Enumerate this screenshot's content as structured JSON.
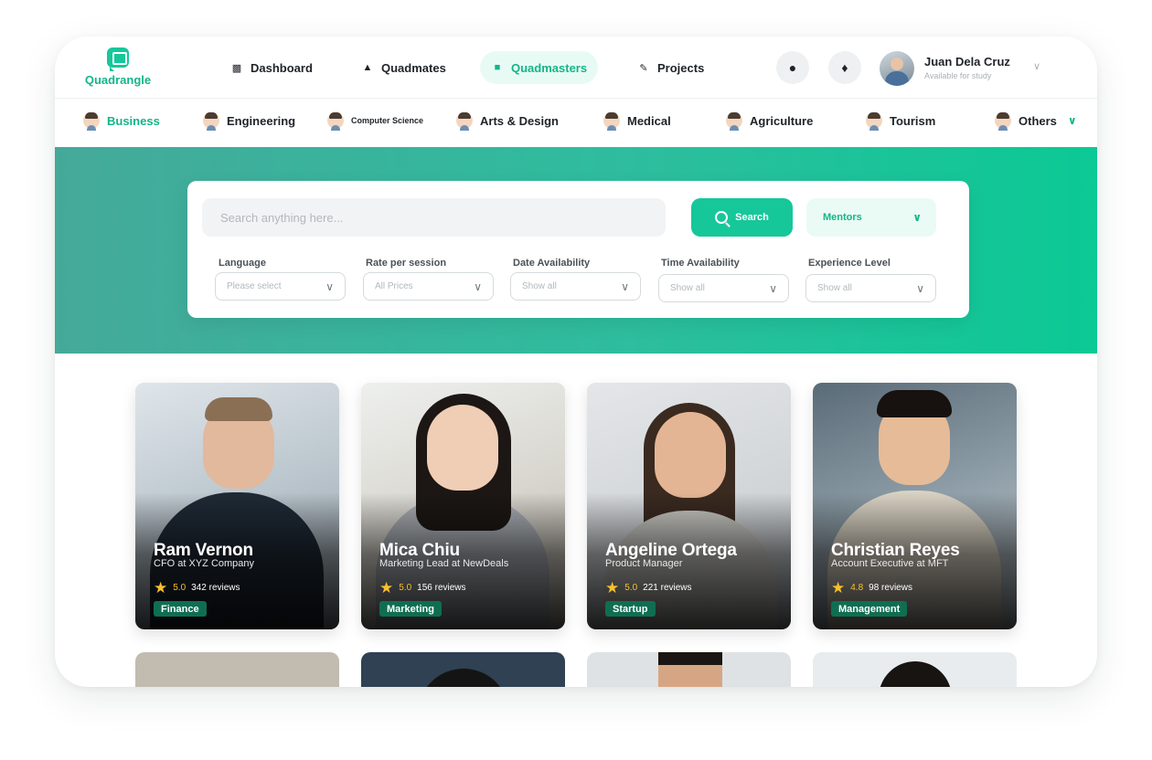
{
  "app": {
    "name": "Quadrangle"
  },
  "topnav": {
    "items": [
      {
        "label": "Dashboard",
        "icon": "calendar-icon",
        "active": false
      },
      {
        "label": "Quadmates",
        "icon": "graduation-cap-icon",
        "active": false
      },
      {
        "label": "Quadmasters",
        "icon": "briefcase-icon",
        "active": true
      },
      {
        "label": "Projects",
        "icon": "notepad-icon",
        "active": false
      }
    ],
    "user": {
      "name": "Juan Dela Cruz",
      "status": "Available for study"
    }
  },
  "categories": [
    {
      "label": "Business",
      "active": true
    },
    {
      "label": "Engineering",
      "active": false
    },
    {
      "label": "Computer Science",
      "active": false
    },
    {
      "label": "Arts & Design",
      "active": false
    },
    {
      "label": "Medical",
      "active": false
    },
    {
      "label": "Agriculture",
      "active": false
    },
    {
      "label": "Tourism",
      "active": false
    },
    {
      "label": "Others",
      "active": false
    }
  ],
  "search": {
    "placeholder": "Search anything here...",
    "button_label": "Search",
    "type_selected": "Mentors"
  },
  "filters": [
    {
      "label": "Language",
      "value": "Please select"
    },
    {
      "label": "Rate per session",
      "value": "All Prices"
    },
    {
      "label": "Date Availability",
      "value": "Show all"
    },
    {
      "label": "Time Availability",
      "value": "Show all"
    },
    {
      "label": "Experience Level",
      "value": "Show all"
    }
  ],
  "mentors": [
    {
      "name": "Ram Vernon",
      "role": "CFO at XYZ Company",
      "rating": "5.0",
      "reviews": "342 reviews",
      "tag": "Finance"
    },
    {
      "name": "Mica Chiu",
      "role": "Marketing Lead at NewDeals",
      "rating": "5.0",
      "reviews": "156 reviews",
      "tag": "Marketing"
    },
    {
      "name": "Angeline Ortega",
      "role": "Product Manager",
      "rating": "5.0",
      "reviews": "221 reviews",
      "tag": "Startup"
    },
    {
      "name": "Christian Reyes",
      "role": "Account Executive at MFT",
      "rating": "4.8",
      "reviews": "98 reviews",
      "tag": "Management"
    }
  ],
  "colors": {
    "accent": "#16c79a",
    "accent_dark": "#13b589",
    "tag_bg": "#0f6e51",
    "star": "#f7c02b"
  }
}
